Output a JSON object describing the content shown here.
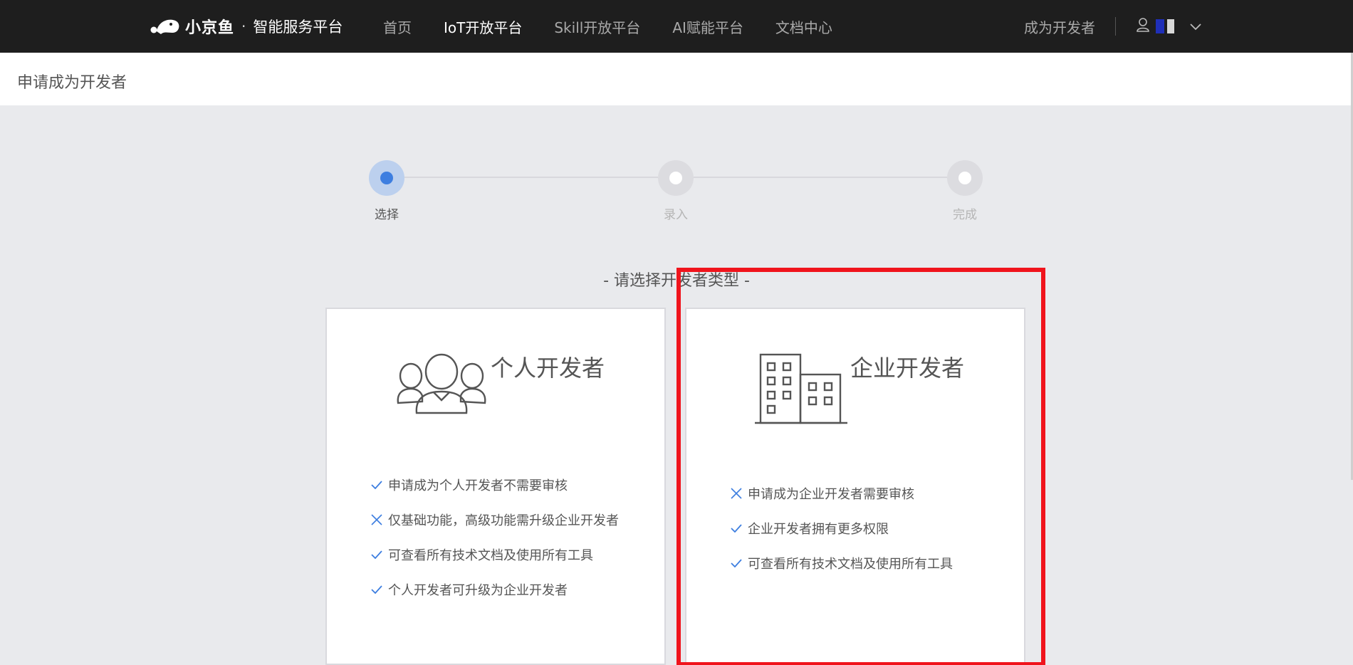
{
  "brand": {
    "name": "小京鱼",
    "separator": "·",
    "subtitle": "智能服务平台"
  },
  "nav": {
    "items": [
      {
        "label": "首页",
        "active": false
      },
      {
        "label": "IoT开放平台",
        "active": true
      },
      {
        "label": "Skill开放平台",
        "active": false
      },
      {
        "label": "AI赋能平台",
        "active": false
      },
      {
        "label": "文档中心",
        "active": false
      }
    ],
    "become_developer": "成为开发者"
  },
  "page": {
    "title": "申请成为开发者"
  },
  "steps": [
    {
      "label": "选择",
      "state": "active"
    },
    {
      "label": "录入",
      "state": "pending"
    },
    {
      "label": "完成",
      "state": "pending"
    }
  ],
  "section_title": "- 请选择开发者类型 -",
  "cards": {
    "personal": {
      "title": "个人开发者",
      "icon": "people-group-icon",
      "features": [
        {
          "mark": "check",
          "text": "申请成为个人开发者不需要审核"
        },
        {
          "mark": "cross",
          "text": "仅基础功能，高级功能需升级企业开发者"
        },
        {
          "mark": "check",
          "text": "可查看所有技术文档及使用所有工具"
        },
        {
          "mark": "check",
          "text": "个人开发者可升级为企业开发者"
        }
      ]
    },
    "enterprise": {
      "title": "企业开发者",
      "icon": "buildings-icon",
      "highlighted": true,
      "features": [
        {
          "mark": "cross",
          "text": "申请成为企业开发者需要审核"
        },
        {
          "mark": "check",
          "text": "企业开发者拥有更多权限"
        },
        {
          "mark": "check",
          "text": "可查看所有技术文档及使用所有工具"
        }
      ]
    }
  },
  "colors": {
    "topbar": "#1e1e1e",
    "accent": "#3d7ee0",
    "highlight": "#f0141c",
    "background": "#e9eaed"
  }
}
